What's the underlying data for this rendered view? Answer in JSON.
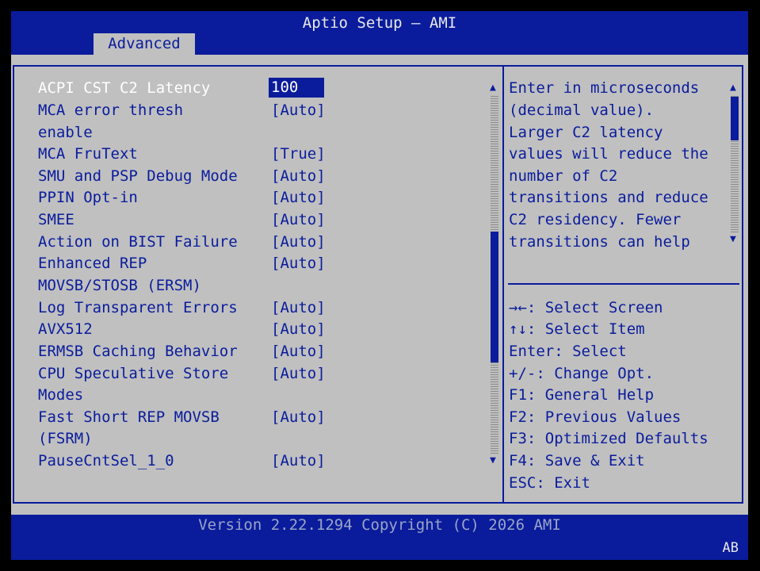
{
  "app": {
    "title": "Aptio Setup – AMI"
  },
  "tabs": [
    {
      "label": "Advanced"
    }
  ],
  "settings": [
    {
      "label": "ACPI CST C2 Latency",
      "value": "100"
    },
    {
      "label": "MCA error thresh",
      "value": "[Auto]"
    },
    {
      "label": "enable",
      "value": ""
    },
    {
      "label": "MCA FruText",
      "value": "[True]"
    },
    {
      "label": "SMU and PSP Debug Mode",
      "value": "[Auto]"
    },
    {
      "label": "PPIN Opt-in",
      "value": "[Auto]"
    },
    {
      "label": "SMEE",
      "value": "[Auto]"
    },
    {
      "label": "Action on BIST Failure",
      "value": "[Auto]"
    },
    {
      "label": "Enhanced REP",
      "value": "[Auto]"
    },
    {
      "label": "MOVSB/STOSB (ERSM)",
      "value": ""
    },
    {
      "label": "Log Transparent Errors",
      "value": "[Auto]"
    },
    {
      "label": "AVX512",
      "value": "[Auto]"
    },
    {
      "label": "ERMSB Caching Behavior",
      "value": "[Auto]"
    },
    {
      "label": "CPU Speculative Store",
      "value": "[Auto]"
    },
    {
      "label": "Modes",
      "value": ""
    },
    {
      "label": "Fast Short REP MOVSB",
      "value": "[Auto]"
    },
    {
      "label": "(FSRM)",
      "value": ""
    },
    {
      "label": "PauseCntSel_1_0",
      "value": "[Auto]"
    }
  ],
  "help": {
    "lines": [
      "Enter in microseconds",
      "(decimal value).",
      "Larger C2 latency",
      "values will reduce the",
      "number of C2",
      "transitions and reduce",
      "C2 residency. Fewer",
      "transitions can help"
    ]
  },
  "keys": [
    "→←: Select Screen",
    "↑↓: Select Item",
    "Enter: Select",
    "+/-: Change Opt.",
    "F1: General Help",
    "F2: Previous Values",
    "F3: Optimized Defaults",
    "F4: Save & Exit",
    "ESC: Exit"
  ],
  "footer": {
    "version": "Version 2.22.1294 Copyright (C) 2026 AMI",
    "badge": "AB"
  },
  "scroll": {
    "settings_position": 0.55,
    "help_position": 0.15
  },
  "icons": {
    "up": "up-arrow-icon",
    "down": "down-arrow-icon"
  },
  "colors": {
    "blue": "#0a1c9c",
    "panel": "#c0c0c0",
    "selected_text": "#ffffff"
  }
}
